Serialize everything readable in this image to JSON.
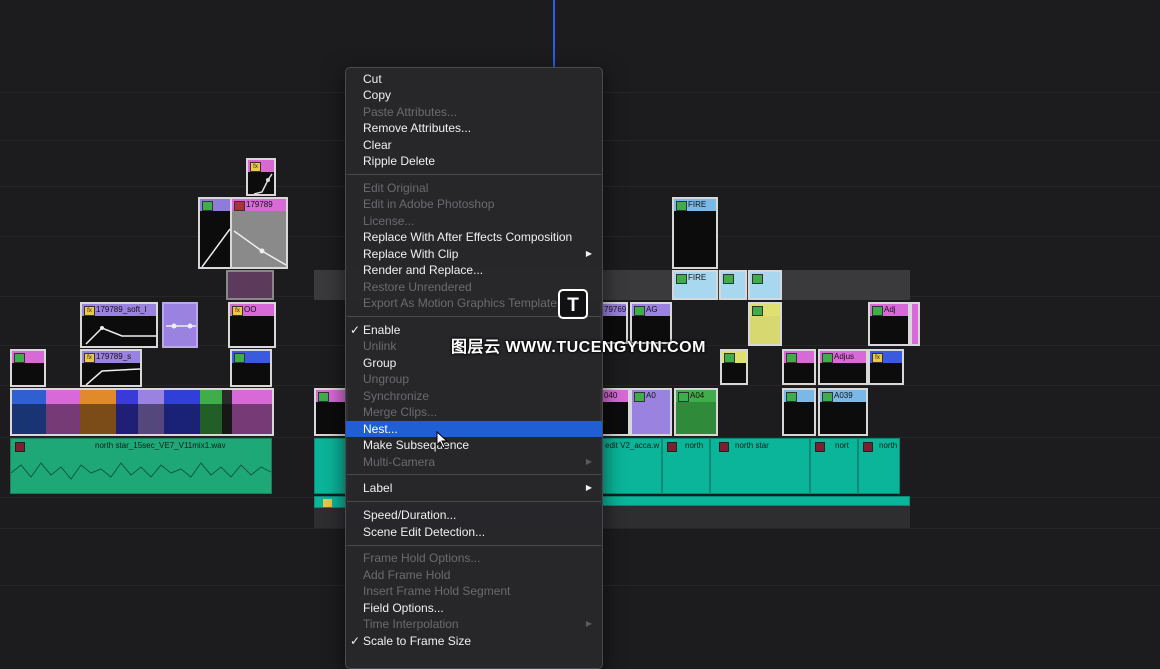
{
  "timeline": {
    "audio_clips": [
      {
        "label": "north star_15sec_VE7_V11mix1.wav"
      },
      {
        "label": "edit V2_acca.w"
      },
      {
        "label": "north"
      },
      {
        "label": "north star"
      },
      {
        "label": "nort"
      },
      {
        "label": "north"
      }
    ],
    "video_clips": [
      {
        "label": "179789"
      },
      {
        "label": "179789_soft_l"
      },
      {
        "label": "179789_s"
      },
      {
        "label": "OO"
      },
      {
        "label": "FIRE"
      },
      {
        "label": "FIRE"
      },
      {
        "label": "79769"
      },
      {
        "label": "AG"
      },
      {
        "label": "A0"
      },
      {
        "label": "A04"
      },
      {
        "label": "040"
      },
      {
        "label": "Adj"
      },
      {
        "label": "Adjus"
      },
      {
        "label": "A039"
      }
    ]
  },
  "context_menu": {
    "items": [
      {
        "label": "Cut",
        "enabled": true
      },
      {
        "label": "Copy",
        "enabled": true
      },
      {
        "label": "Paste Attributes...",
        "enabled": false
      },
      {
        "label": "Remove Attributes...",
        "enabled": true
      },
      {
        "label": "Clear",
        "enabled": true
      },
      {
        "label": "Ripple Delete",
        "enabled": true
      },
      {
        "label": "Edit Original",
        "enabled": false
      },
      {
        "label": "Edit in Adobe Photoshop",
        "enabled": false
      },
      {
        "label": "License...",
        "enabled": false
      },
      {
        "label": "Replace With After Effects Composition",
        "enabled": true
      },
      {
        "label": "Replace With Clip",
        "enabled": true,
        "submenu": true
      },
      {
        "label": "Render and Replace...",
        "enabled": true
      },
      {
        "label": "Restore Unrendered",
        "enabled": false
      },
      {
        "label": "Export As Motion Graphics Template",
        "enabled": false
      },
      {
        "label": "Enable",
        "enabled": true,
        "checked": true
      },
      {
        "label": "Unlink",
        "enabled": false
      },
      {
        "label": "Group",
        "enabled": true
      },
      {
        "label": "Ungroup",
        "enabled": false
      },
      {
        "label": "Synchronize",
        "enabled": false
      },
      {
        "label": "Merge Clips...",
        "enabled": false
      },
      {
        "label": "Nest...",
        "enabled": true,
        "highlighted": true
      },
      {
        "label": "Make Subsequence",
        "enabled": true
      },
      {
        "label": "Multi-Camera",
        "enabled": false,
        "submenu": true
      },
      {
        "label": "Label",
        "enabled": true,
        "submenu": true
      },
      {
        "label": "Speed/Duration...",
        "enabled": true
      },
      {
        "label": "Scene Edit Detection...",
        "enabled": true
      },
      {
        "label": "Frame Hold Options...",
        "enabled": false
      },
      {
        "label": "Add Frame Hold",
        "enabled": false
      },
      {
        "label": "Insert Frame Hold Segment",
        "enabled": false
      },
      {
        "label": "Field Options...",
        "enabled": true
      },
      {
        "label": "Time Interpolation",
        "enabled": false,
        "submenu": true
      },
      {
        "label": "Scale to Frame Size",
        "enabled": true,
        "checked": true
      }
    ],
    "check_mark": "✓",
    "submenu_arrow": "▶"
  },
  "watermark": {
    "logo_letter": "T",
    "text": "图层云 WWW.TUCENGYUN.COM"
  },
  "colors": {
    "highlight": "#1f5fd3",
    "playhead": "#2b5ee0",
    "audio_green": "#1fa877",
    "audio_teal": "#0bb59a"
  }
}
